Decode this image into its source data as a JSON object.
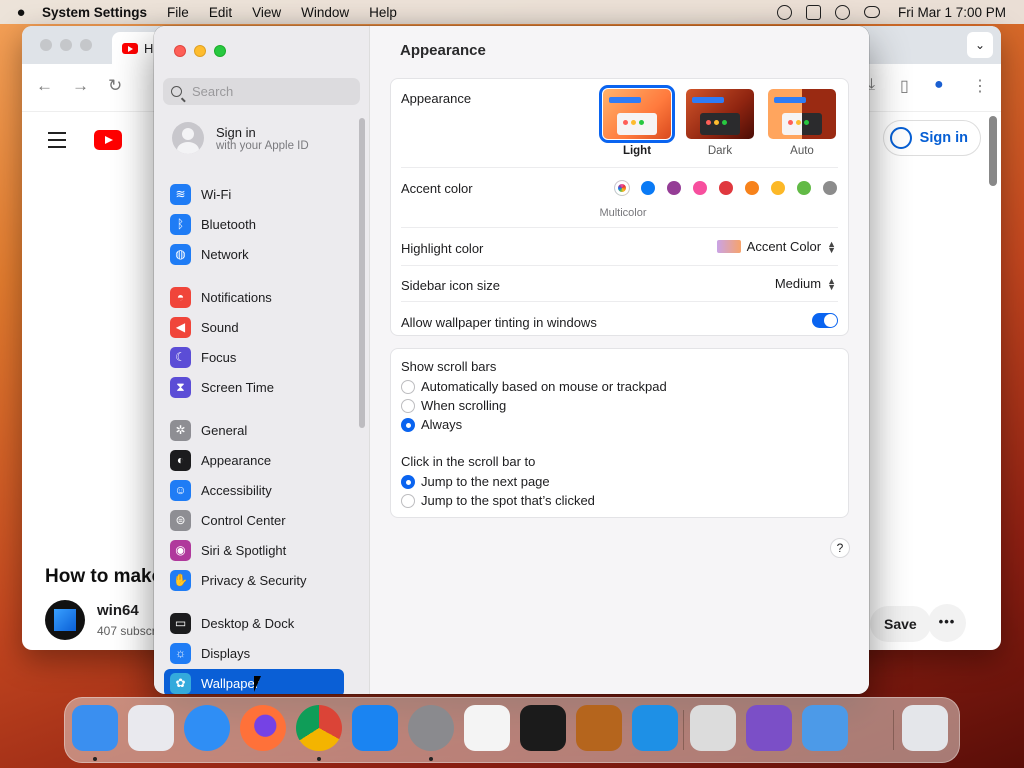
{
  "menubar": {
    "app": "System Settings",
    "items": [
      "File",
      "Edit",
      "View",
      "Window",
      "Help"
    ],
    "clock": "Fri Mar 1  7:00 PM"
  },
  "browser": {
    "tab_title": "H",
    "signin": "Sign in",
    "video_title": "How to make",
    "channel_name": "win64",
    "channel_subs": "407 subscr",
    "save": "Save"
  },
  "sidebar": {
    "search_placeholder": "Search",
    "account": {
      "title": "Sign in",
      "subtitle": "with your Apple ID"
    },
    "items": [
      {
        "label": "Wi-Fi",
        "icon": "wifi-icon",
        "color": "#1f7cf5"
      },
      {
        "label": "Bluetooth",
        "icon": "bluetooth-icon",
        "color": "#1f7cf5"
      },
      {
        "label": "Network",
        "icon": "globe-icon",
        "color": "#1f7cf5"
      },
      {
        "label": "Notifications",
        "icon": "bell-icon",
        "color": "#f0453a"
      },
      {
        "label": "Sound",
        "icon": "speaker-icon",
        "color": "#f0453a"
      },
      {
        "label": "Focus",
        "icon": "moon-icon",
        "color": "#5b4dd6"
      },
      {
        "label": "Screen Time",
        "icon": "hourglass-icon",
        "color": "#5b4dd6"
      },
      {
        "label": "General",
        "icon": "gear-icon",
        "color": "#8e8e93"
      },
      {
        "label": "Appearance",
        "icon": "appearance-icon",
        "color": "#1c1c1e"
      },
      {
        "label": "Accessibility",
        "icon": "accessibility-icon",
        "color": "#1f7cf5"
      },
      {
        "label": "Control Center",
        "icon": "toggles-icon",
        "color": "#8e8e93"
      },
      {
        "label": "Siri & Spotlight",
        "icon": "siri-icon",
        "color": "#b0399c"
      },
      {
        "label": "Privacy & Security",
        "icon": "hand-icon",
        "color": "#1f7cf5"
      },
      {
        "label": "Desktop & Dock",
        "icon": "dock-icon",
        "color": "#1c1c1e"
      },
      {
        "label": "Displays",
        "icon": "sun-icon",
        "color": "#1f7cf5"
      },
      {
        "label": "Wallpaper",
        "icon": "flower-icon",
        "color": "#34aadc"
      }
    ],
    "selected": "Wallpaper"
  },
  "main": {
    "title": "Appearance",
    "appearance_label": "Appearance",
    "modes": [
      {
        "label": "Light",
        "selected": true
      },
      {
        "label": "Dark",
        "selected": false
      },
      {
        "label": "Auto",
        "selected": false
      }
    ],
    "accent_label": "Accent color",
    "accent_colors": [
      "multicolor",
      "#0a7af5",
      "#953d96",
      "#f74f9e",
      "#e0383e",
      "#f7821b",
      "#fcb827",
      "#62ba46",
      "#8c8c8c"
    ],
    "accent_selected_name": "Multicolor",
    "highlight_label": "Highlight color",
    "highlight_value": "Accent Color",
    "icon_size_label": "Sidebar icon size",
    "icon_size_value": "Medium",
    "tinting_label": "Allow wallpaper tinting in windows",
    "tinting_on": true,
    "scroll_label": "Show scroll bars",
    "scroll_options": [
      {
        "label": "Automatically based on mouse or trackpad",
        "selected": false
      },
      {
        "label": "When scrolling",
        "selected": false
      },
      {
        "label": "Always",
        "selected": true
      }
    ],
    "click_label": "Click in the scroll bar to",
    "click_options": [
      {
        "label": "Jump to the next page",
        "selected": true
      },
      {
        "label": "Jump to the spot that’s clicked",
        "selected": false
      }
    ],
    "help": "?"
  },
  "dock": {
    "apps": [
      "Finder",
      "Launchpad",
      "Safari",
      "Firefox",
      "Chrome",
      "App Store",
      "System Settings",
      "TextEdit",
      "Terminal",
      "GarageBand",
      "VS Code",
      "Disk Utility",
      "Visual Studio",
      "Migration Assistant",
      "Trash"
    ],
    "colors": [
      "#3a8ff0",
      "#e9e9ee",
      "#2f8ef5",
      "#e8642a",
      "#ffffff",
      "#1a84f2",
      "#8a8a8e",
      "#f4f4f4",
      "#1b1b1b",
      "#b5651d",
      "#1e90e6",
      "#dcdcdc",
      "#7b4fc7",
      "#4c9ae8",
      "#e4e6ea"
    ]
  }
}
